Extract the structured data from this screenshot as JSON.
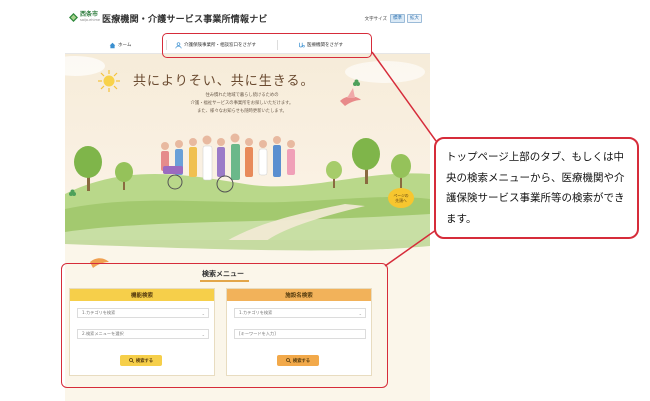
{
  "header": {
    "logo_city": "西条市",
    "logo_url": "saijo.ehime",
    "site_title": "医療機関・介護サービス事業所情報ナビ",
    "font_size_label": "文字サイズ",
    "font_size_options": [
      "標準",
      "拡大"
    ]
  },
  "tabs": [
    {
      "label": "ホーム"
    },
    {
      "label": "介護保険事業所・相談窓口をさがす"
    },
    {
      "label": "医療機関をさがす"
    }
  ],
  "hero": {
    "title": "共によりそい、共に生きる。",
    "text_lines": [
      "住み慣れた地域で暮らし続けるための",
      "介護・福祉サービスの事業所をお探しいただけます。",
      "また、様々なお知らせも随時更新いたします。"
    ],
    "badge": [
      "ページの",
      "先頭へ"
    ]
  },
  "search_menu": {
    "title": "検索メニュー",
    "left_panel": {
      "heading": "機能検索",
      "select1": "1.カテゴリを検索",
      "select2": "2.検索メニューを選択",
      "button": "検索する"
    },
    "right_panel": {
      "heading": "施設名検索",
      "select1": "1.カテゴリを検索",
      "input_placeholder": "[キーワードを入力]",
      "button": "検索する"
    }
  },
  "callout": {
    "text": "トップページ上部のタブ、もしくは中央の検索メニューから、医療機関や介護保険サービス事業所等の検索ができます。"
  },
  "colors": {
    "annotation_red": "#d62c3a",
    "panel_yellow": "#f6cf4a",
    "panel_orange": "#f2b25a",
    "hero_bg": "#f6ecd9"
  }
}
